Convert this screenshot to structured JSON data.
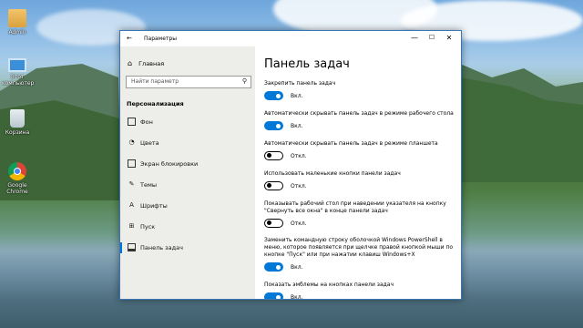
{
  "desktop": {
    "icons": [
      {
        "label": "Admin",
        "icon": "user-folder-icon"
      },
      {
        "label": "Этот компьютер",
        "icon": "computer-icon"
      },
      {
        "label": "Корзина",
        "icon": "recycle-bin-icon"
      },
      {
        "label": "Google Chrome",
        "icon": "chrome-icon"
      }
    ]
  },
  "window": {
    "title": "Параметры",
    "back_icon": "←",
    "minimize": "—",
    "maximize": "☐",
    "close": "✕"
  },
  "sidebar": {
    "home_label": "Главная",
    "search_placeholder": "Найти параметр",
    "section_title": "Персонализация",
    "items": [
      {
        "label": "Фон",
        "icon": "picture-icon"
      },
      {
        "label": "Цвета",
        "icon": "palette-icon"
      },
      {
        "label": "Экран блокировки",
        "icon": "lock-screen-icon"
      },
      {
        "label": "Темы",
        "icon": "themes-icon"
      },
      {
        "label": "Шрифты",
        "icon": "fonts-icon"
      },
      {
        "label": "Пуск",
        "icon": "start-icon"
      },
      {
        "label": "Панель задач",
        "icon": "taskbar-icon",
        "active": true
      }
    ]
  },
  "main": {
    "title": "Панель задач",
    "settings": [
      {
        "label": "Закрепить панель задач",
        "state": "Вкл.",
        "on": true
      },
      {
        "label": "Автоматически скрывать панель задач в режиме рабочего стола",
        "state": "Вкл.",
        "on": true
      },
      {
        "label": "Автоматически скрывать панель задач в режиме планшета",
        "state": "Откл.",
        "on": false
      },
      {
        "label": "Использовать маленькие кнопки панели задач",
        "state": "Откл.",
        "on": false
      },
      {
        "label": "Показывать рабочий стол при наведении указателя на кнопку \"Свернуть все окна\" в конце панели задач",
        "state": "Откл.",
        "on": false
      },
      {
        "label": "Заменить командную строку оболочкой Windows PowerShell в меню, которое появляется при щелчке правой кнопкой мыши по кнопке \"Пуск\" или при нажатии клавиш Windows+X",
        "state": "Вкл.",
        "on": true
      },
      {
        "label": "Показать эмблемы на кнопках панели задач",
        "state": "Вкл.",
        "on": true
      }
    ]
  },
  "colors": {
    "accent": "#0078d7"
  }
}
